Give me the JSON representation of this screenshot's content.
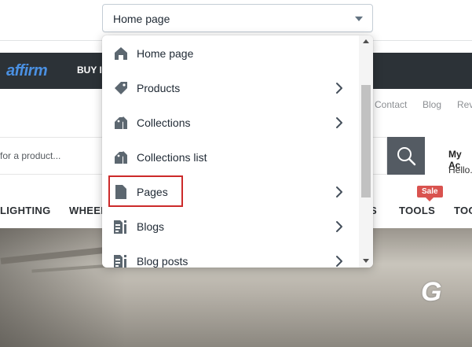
{
  "select": {
    "value": "Home page"
  },
  "dropdown": {
    "items": [
      {
        "label": "Home page",
        "icon": "home-icon",
        "has_submenu": false
      },
      {
        "label": "Products",
        "icon": "tag-icon",
        "has_submenu": true
      },
      {
        "label": "Collections",
        "icon": "tags-icon",
        "has_submenu": true
      },
      {
        "label": "Collections list",
        "icon": "tags-icon",
        "has_submenu": false
      },
      {
        "label": "Pages",
        "icon": "page-icon",
        "has_submenu": true
      },
      {
        "label": "Blogs",
        "icon": "blog-icon",
        "has_submenu": true
      },
      {
        "label": "Blog posts",
        "icon": "blog-icon",
        "has_submenu": true
      }
    ],
    "highlighted": "Pages"
  },
  "storefront": {
    "banner": {
      "logo": "affirm",
      "text": "BUY I"
    },
    "navlinks": [
      "Contact",
      "Blog",
      "Rev"
    ],
    "search": {
      "placeholder": "for a product..."
    },
    "account": {
      "title": "My Ac",
      "subtitle": "Hello."
    },
    "categories": [
      "LIGHTING",
      "WHEEL",
      "S",
      "TOOLS",
      "TOO"
    ],
    "sale_badge": "Sale",
    "hero_text": "G"
  },
  "colors": {
    "banner": "#2c3237",
    "affirm": "#4a90e2",
    "sale": "#d9534f",
    "highlight": "#cc2a2a",
    "search_button": "#545b63"
  }
}
